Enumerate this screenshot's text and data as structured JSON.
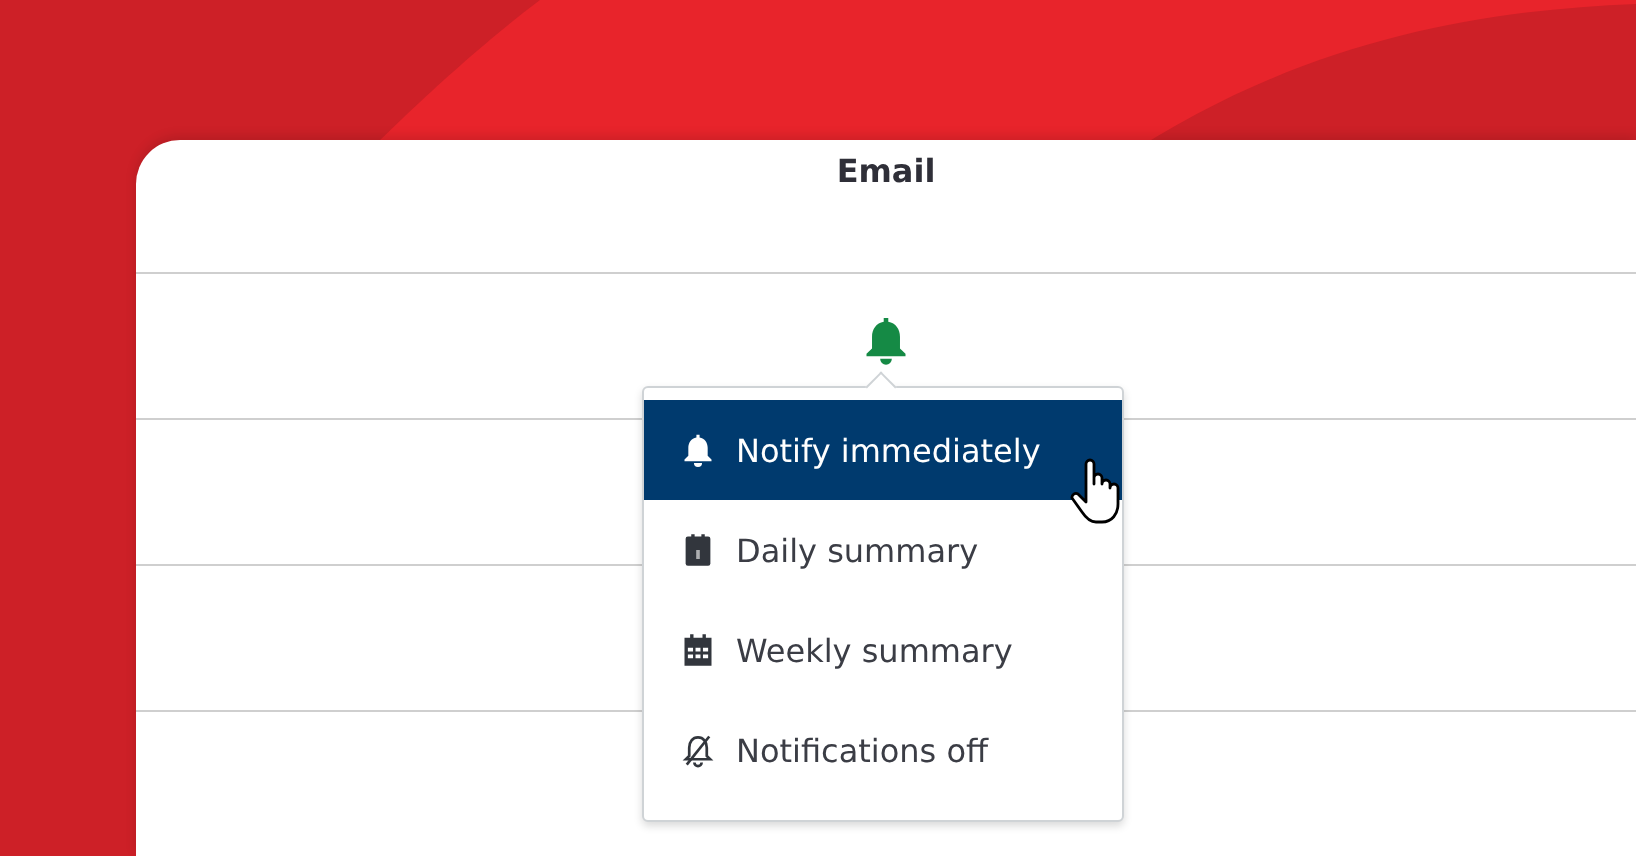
{
  "column": {
    "header": "Email"
  },
  "menu": {
    "items": [
      {
        "kind": "bell",
        "label": "Notify immediately",
        "selected": true
      },
      {
        "kind": "day",
        "label": "Daily summary",
        "selected": false
      },
      {
        "kind": "week",
        "label": "Weekly summary",
        "selected": false
      },
      {
        "kind": "off",
        "label": "Notifications off",
        "selected": false
      }
    ]
  }
}
